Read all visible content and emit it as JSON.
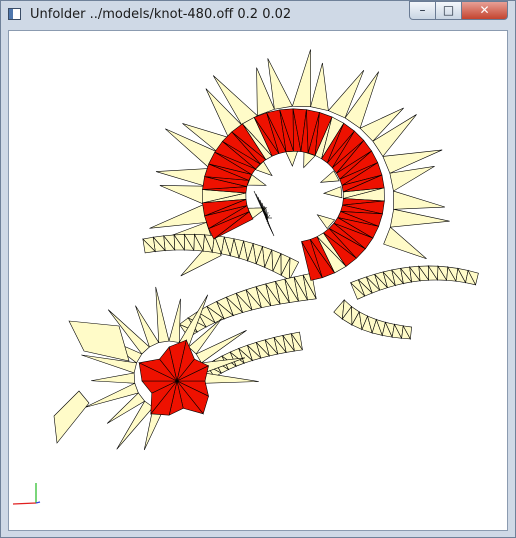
{
  "window": {
    "title": "Unfolder ../models/knot-480.off 0.2 0.02",
    "controls": {
      "minimize": "–",
      "maximize": "□",
      "close": "✕"
    },
    "icon": "app-window-icon"
  },
  "viewport": {
    "background": "#ffffff",
    "face_color": "#fffbc8",
    "highlight_color": "#ee1100",
    "edge_color": "#000000",
    "axis_colors": {
      "x": "#e02020",
      "y": "#22bb22",
      "z": "#3344dd"
    }
  }
}
